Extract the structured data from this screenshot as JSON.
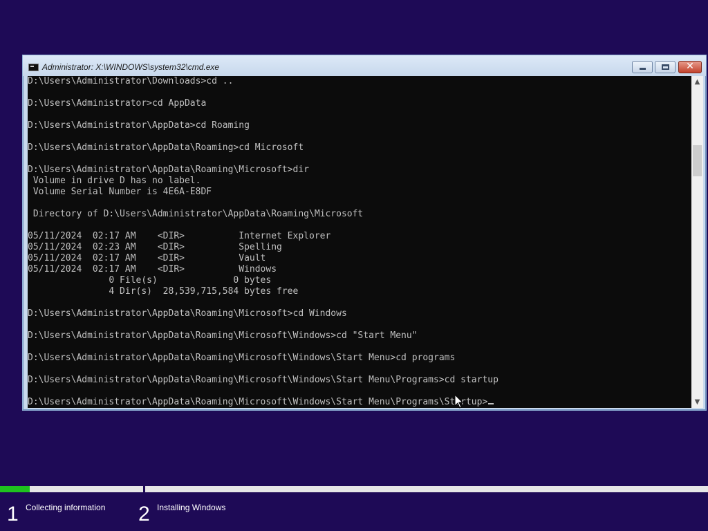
{
  "window": {
    "title": "Administrator: X:\\WINDOWS\\system32\\cmd.exe",
    "controls": {
      "minimize": "minimize",
      "maximize": "maximize",
      "close": "✕"
    }
  },
  "console": {
    "lines": [
      "D:\\Users\\Administrator\\Downloads>cd ..",
      "",
      "D:\\Users\\Administrator>cd AppData",
      "",
      "D:\\Users\\Administrator\\AppData>cd Roaming",
      "",
      "D:\\Users\\Administrator\\AppData\\Roaming>cd Microsoft",
      "",
      "D:\\Users\\Administrator\\AppData\\Roaming\\Microsoft>dir",
      " Volume in drive D has no label.",
      " Volume Serial Number is 4E6A-E8DF",
      "",
      " Directory of D:\\Users\\Administrator\\AppData\\Roaming\\Microsoft",
      "",
      "05/11/2024  02:17 AM    <DIR>          Internet Explorer",
      "05/11/2024  02:23 AM    <DIR>          Spelling",
      "05/11/2024  02:17 AM    <DIR>          Vault",
      "05/11/2024  02:17 AM    <DIR>          Windows",
      "               0 File(s)              0 bytes",
      "               4 Dir(s)  28,539,715,584 bytes free",
      "",
      "D:\\Users\\Administrator\\AppData\\Roaming\\Microsoft>cd Windows",
      "",
      "D:\\Users\\Administrator\\AppData\\Roaming\\Microsoft\\Windows>cd \"Start Menu\"",
      "",
      "D:\\Users\\Administrator\\AppData\\Roaming\\Microsoft\\Windows\\Start Menu>cd programs",
      "",
      "D:\\Users\\Administrator\\AppData\\Roaming\\Microsoft\\Windows\\Start Menu\\Programs>cd startup",
      ""
    ],
    "prompt": "D:\\Users\\Administrator\\AppData\\Roaming\\Microsoft\\Windows\\Start Menu\\Programs\\Startup>"
  },
  "scrollbar": {
    "up_arrow": "▲",
    "down_arrow": "▼"
  },
  "setup": {
    "progress_fraction": 0.21,
    "accent_color": "#1fc21f",
    "steps": [
      {
        "number": "1",
        "label": "Collecting information"
      },
      {
        "number": "2",
        "label": "Installing Windows"
      }
    ]
  },
  "colors": {
    "background": "#1e0a56",
    "console_bg": "#0c0c0c",
    "console_fg": "#c0c0c0"
  },
  "icons": {
    "window_icon": "cmd-icon",
    "pointer": "mouse-cursor-icon"
  }
}
